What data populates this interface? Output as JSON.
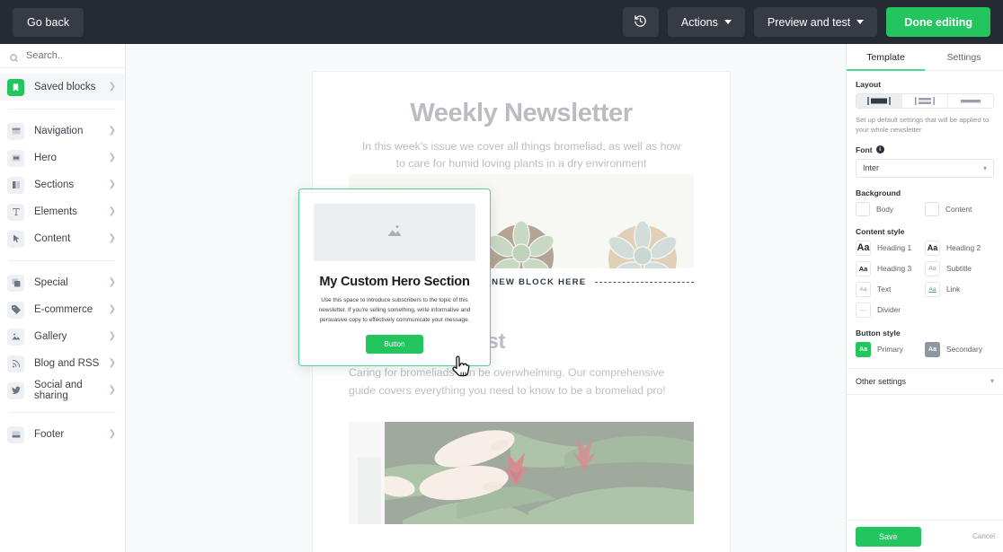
{
  "topbar": {
    "go_back": "Go back",
    "history_icon": "history-undo-icon",
    "actions": "Actions",
    "preview": "Preview and test",
    "done": "Done editing",
    "bg_color": "#262b33",
    "accent_color": "#22c55e"
  },
  "sidebar": {
    "search_placeholder": "Search..",
    "groups": [
      {
        "items": [
          {
            "label": "Saved blocks",
            "icon": "bookmark-icon",
            "active": true,
            "accent": true
          }
        ]
      },
      {
        "items": [
          {
            "label": "Navigation",
            "icon": "navigation-bar-icon"
          },
          {
            "label": "Hero",
            "icon": "hero-block-icon"
          },
          {
            "label": "Sections",
            "icon": "columns-icon"
          },
          {
            "label": "Elements",
            "icon": "text-t-icon"
          },
          {
            "label": "Content",
            "icon": "cursor-arrow-icon"
          }
        ]
      },
      {
        "items": [
          {
            "label": "Special",
            "icon": "layers-icon"
          },
          {
            "label": "E-commerce",
            "icon": "price-tag-icon"
          },
          {
            "label": "Gallery",
            "icon": "image-mountain-icon"
          },
          {
            "label": "Blog and RSS",
            "icon": "rss-icon"
          },
          {
            "label": "Social and sharing",
            "icon": "twitter-bird-icon"
          }
        ]
      },
      {
        "items": [
          {
            "label": "Footer",
            "icon": "footer-block-icon"
          }
        ]
      }
    ]
  },
  "canvas": {
    "newsletter": {
      "title": "Weekly Newsletter",
      "subtitle": "In this week's issue we cover all things bromeliad, as well as how to care for humid loving plants in a dry environment",
      "hero_image_alt": "top-down photo of potted succulents and cactus on white background",
      "add_block_label": "ADD A NEW BLOCK HERE",
      "post_title": "Our Latest Post",
      "post_body": "Caring for bromeliads can be overwhelming. Our comprehensive guide covers everything you need to know to be a bromeliad pro!",
      "post_image_alt": "hands tending a red bromeliad plant"
    },
    "drag_card": {
      "image_placeholder_icon": "image-mountain-icon",
      "title": "My Custom Hero Section",
      "body": "Use this space to introduce subscribers to the topic of this newsletter. If you're selling something, write informative and persuasive copy to effectively communicate your message.",
      "button": "Button",
      "border_color": "#4ed68f"
    },
    "cursor_icon": "pointing-hand-cursor"
  },
  "panel": {
    "tabs": [
      {
        "label": "Template",
        "active": true
      },
      {
        "label": "Settings",
        "active": false
      }
    ],
    "layout": {
      "label": "Layout",
      "options": [
        {
          "icon": "layout-single-wide-icon",
          "selected": true
        },
        {
          "icon": "layout-two-column-icon",
          "selected": false
        },
        {
          "icon": "layout-full-width-icon",
          "selected": false
        }
      ]
    },
    "help_text": "Set up default settings that will be applied to your whole newsletter",
    "font": {
      "label": "Font",
      "info_icon": "info-icon",
      "value": "Inter",
      "chevron": "chevron-down-icon"
    },
    "background": {
      "label": "Background",
      "items": [
        {
          "label": "Body",
          "color": "#ffffff"
        },
        {
          "label": "Content",
          "color": "#ffffff"
        }
      ]
    },
    "content_style": {
      "label": "Content style",
      "items": [
        {
          "label": "Heading 1",
          "glyph": "Aa",
          "kind": "h1"
        },
        {
          "label": "Heading 2",
          "glyph": "Aa",
          "kind": "h2"
        },
        {
          "label": "Heading 3",
          "glyph": "Aa",
          "kind": "h3"
        },
        {
          "label": "Subtitle",
          "glyph": "Aa",
          "kind": "sub"
        },
        {
          "label": "Text",
          "glyph": "Aa",
          "kind": "txt"
        },
        {
          "label": "Link",
          "glyph": "Aa",
          "kind": "link"
        },
        {
          "label": "Divider",
          "glyph": "—",
          "kind": "div"
        }
      ]
    },
    "button_style": {
      "label": "Button style",
      "items": [
        {
          "label": "Primary",
          "glyph": "Aa",
          "kind": "primary",
          "color": "#22c55e"
        },
        {
          "label": "Secondary",
          "glyph": "Aa",
          "kind": "secondary",
          "color": "#8d96a3"
        }
      ]
    },
    "other_settings": {
      "label": "Other settings",
      "chevron": "chevron-down-icon"
    },
    "footer": {
      "save": "Save",
      "cancel": "Cancel"
    }
  }
}
